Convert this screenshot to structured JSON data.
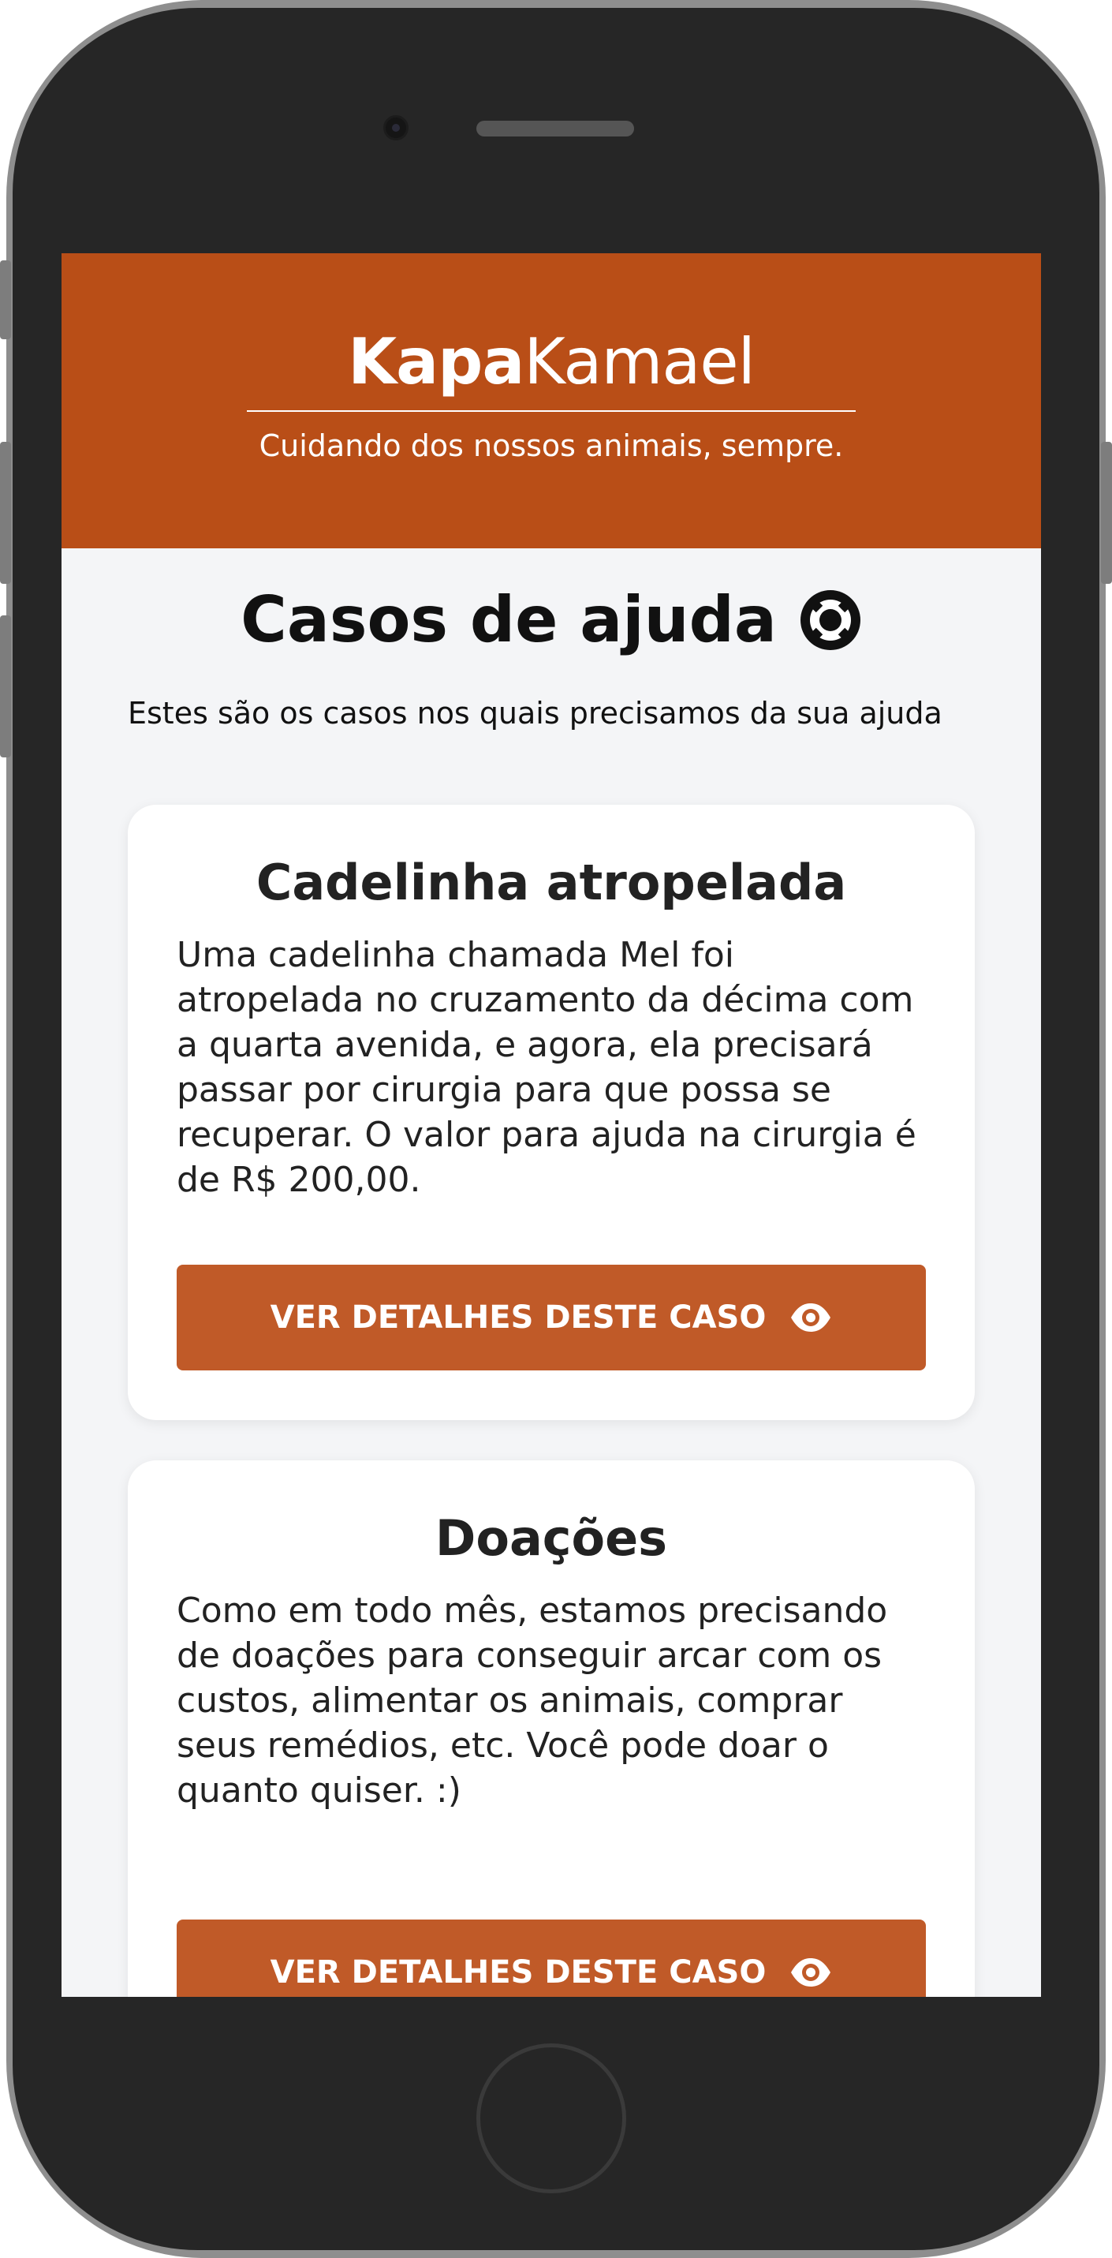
{
  "header": {
    "logo_bold": "Kapa",
    "logo_light": "Kamael",
    "tagline": "Cuidando dos nossos animais, sempre."
  },
  "page": {
    "title": "Casos de ajuda",
    "title_icon": "lifebuoy-icon",
    "intro": "Estes são os casos nos quais precisamos da sua ajuda"
  },
  "cases": [
    {
      "title": "Cadelinha atropelada",
      "description": "Uma cadelinha chamada Mel foi atropelada no cruzamento da décima com a quarta avenida, e agora, ela precisará passar por cirurgia para que possa se recuperar. O valor para ajuda na cirurgia é de R$ 200,00.",
      "button_label": "VER DETALHES DESTE CASO",
      "button_icon": "eye-icon"
    },
    {
      "title": "Doações",
      "description": "Como em todo mês, estamos precisando de doações para conseguir arcar com os custos, alimentar os animais, comprar seus remédios, etc. Você pode doar o quanto quiser. :)",
      "button_label": "VER DETALHES DESTE CASO",
      "button_icon": "eye-icon"
    }
  ],
  "colors": {
    "brand": "#b94e17",
    "button": "#c05a28",
    "background": "#f4f5f7"
  }
}
